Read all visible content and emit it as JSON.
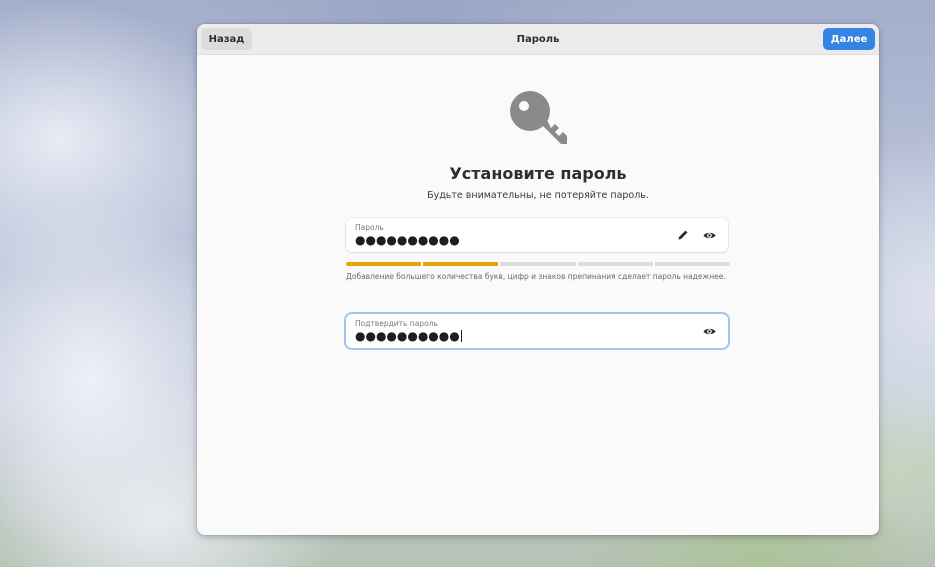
{
  "header": {
    "back_label": "Назад",
    "title": "Пароль",
    "next_label": "Далее"
  },
  "main": {
    "icon": "key-icon",
    "title": "Установите пароль",
    "subtitle": "Будьте внимательны, не потеряйте пароль."
  },
  "password": {
    "label": "Пароль",
    "value": "●●●●●●●●●●",
    "edit_icon": "pencil-icon",
    "reveal_icon": "eye-icon"
  },
  "strength": {
    "segments_total": 5,
    "segments_filled": 2,
    "color": "#e5a50a",
    "hint": "Добавление большего количества букв, цифр и знаков препинания сделает пароль надежнее."
  },
  "confirm": {
    "label": "Подтвердить пароль",
    "value": "●●●●●●●●●●",
    "reveal_icon": "eye-icon"
  },
  "colors": {
    "accent": "#3584e4",
    "strength": "#e5a50a"
  }
}
